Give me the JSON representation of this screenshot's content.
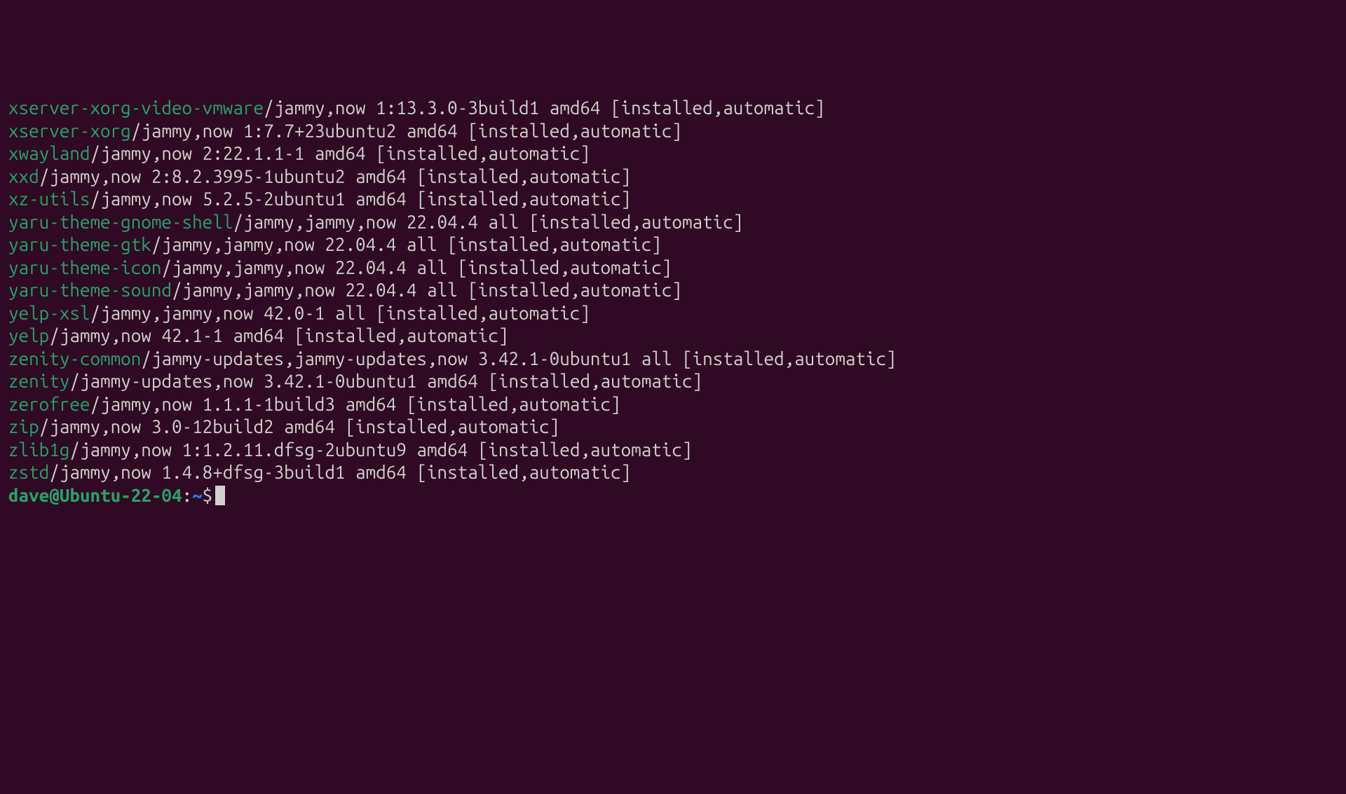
{
  "packages": [
    {
      "name": "xserver-xorg-video-vmware",
      "rest": "/jammy,now 1:13.3.0-3build1 amd64 [installed,automatic]"
    },
    {
      "name": "xserver-xorg",
      "rest": "/jammy,now 1:7.7+23ubuntu2 amd64 [installed,automatic]"
    },
    {
      "name": "xwayland",
      "rest": "/jammy,now 2:22.1.1-1 amd64 [installed,automatic]"
    },
    {
      "name": "xxd",
      "rest": "/jammy,now 2:8.2.3995-1ubuntu2 amd64 [installed,automatic]"
    },
    {
      "name": "xz-utils",
      "rest": "/jammy,now 5.2.5-2ubuntu1 amd64 [installed,automatic]"
    },
    {
      "name": "yaru-theme-gnome-shell",
      "rest": "/jammy,jammy,now 22.04.4 all [installed,automatic]"
    },
    {
      "name": "yaru-theme-gtk",
      "rest": "/jammy,jammy,now 22.04.4 all [installed,automatic]"
    },
    {
      "name": "yaru-theme-icon",
      "rest": "/jammy,jammy,now 22.04.4 all [installed,automatic]"
    },
    {
      "name": "yaru-theme-sound",
      "rest": "/jammy,jammy,now 22.04.4 all [installed,automatic]"
    },
    {
      "name": "yelp-xsl",
      "rest": "/jammy,jammy,now 42.0-1 all [installed,automatic]"
    },
    {
      "name": "yelp",
      "rest": "/jammy,now 42.1-1 amd64 [installed,automatic]"
    },
    {
      "name": "zenity-common",
      "rest": "/jammy-updates,jammy-updates,now 3.42.1-0ubuntu1 all [installed,automatic]"
    },
    {
      "name": "zenity",
      "rest": "/jammy-updates,now 3.42.1-0ubuntu1 amd64 [installed,automatic]"
    },
    {
      "name": "zerofree",
      "rest": "/jammy,now 1.1.1-1build3 amd64 [installed,automatic]"
    },
    {
      "name": "zip",
      "rest": "/jammy,now 3.0-12build2 amd64 [installed,automatic]"
    },
    {
      "name": "zlib1g",
      "rest": "/jammy,now 1:1.2.11.dfsg-2ubuntu9 amd64 [installed,automatic]"
    },
    {
      "name": "zstd",
      "rest": "/jammy,now 1.4.8+dfsg-3build1 amd64 [installed,automatic]"
    }
  ],
  "prompt": {
    "user": "dave",
    "at": "@",
    "host": "Ubuntu-22-04",
    "colon": ":",
    "path": "~",
    "dollar": "$"
  }
}
